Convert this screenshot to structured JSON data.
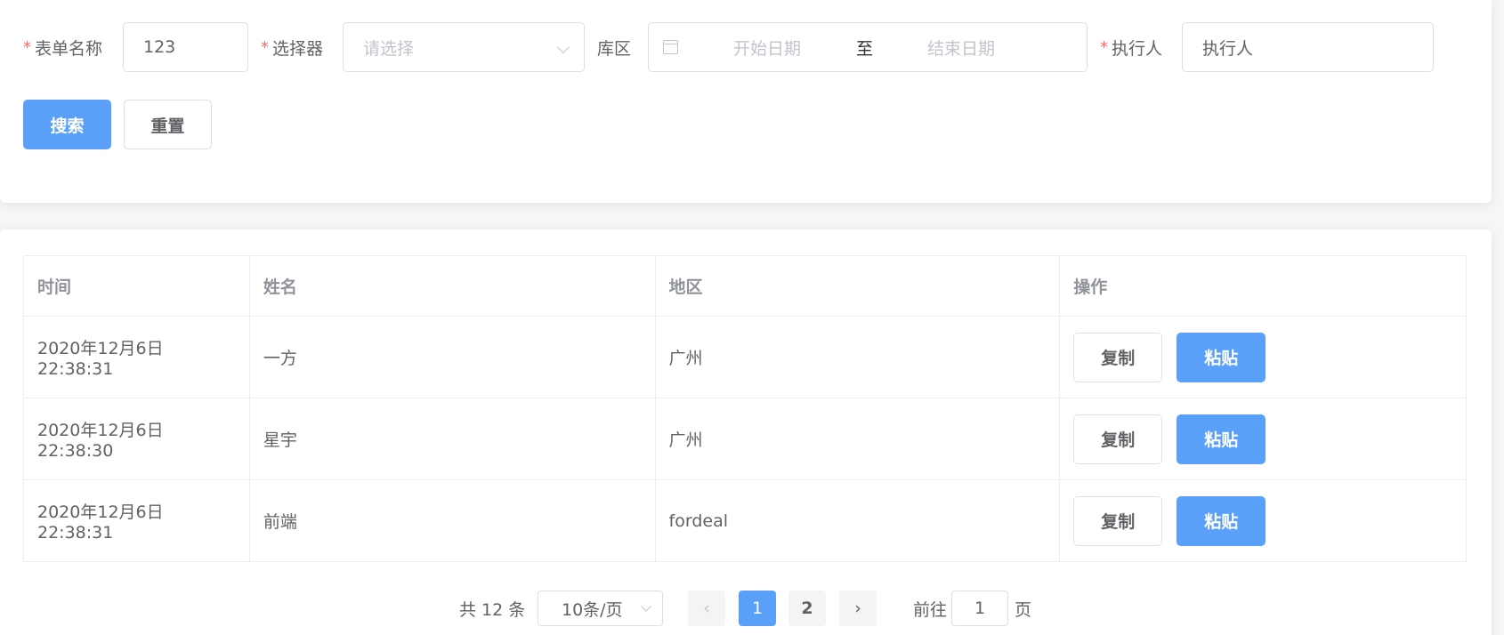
{
  "search": {
    "form_name_label": "表单名称",
    "form_name_value": "123",
    "selector_label": "选择器",
    "selector_placeholder": "请选择",
    "area_label": "库区",
    "start_date_placeholder": "开始日期",
    "range_separator": "至",
    "end_date_placeholder": "结束日期",
    "executor_label": "执行人",
    "executor_value": "执行人",
    "required_mark": "*",
    "search_button": "搜索",
    "reset_button": "重置"
  },
  "table": {
    "headers": [
      "时间",
      "姓名",
      "地区",
      "操作"
    ],
    "rows": [
      {
        "time": "2020年12月6日22:38:31",
        "name": "一方",
        "region": "广州"
      },
      {
        "time": "2020年12月6日22:38:30",
        "name": "星宇",
        "region": "广州"
      },
      {
        "time": "2020年12月6日22:38:31",
        "name": "前端",
        "region": "fordeal"
      }
    ],
    "copy_label": "复制",
    "paste_label": "粘贴"
  },
  "pagination": {
    "total_text": "共 12 条",
    "page_size": "10条/页",
    "pages": [
      "1",
      "2"
    ],
    "current_page": "1",
    "goto_prefix": "前往",
    "goto_value": "1",
    "goto_suffix": "页"
  },
  "colors": {
    "primary": "#5aa0f8",
    "required": "#f56c6c",
    "border": "#dcdfe6"
  }
}
